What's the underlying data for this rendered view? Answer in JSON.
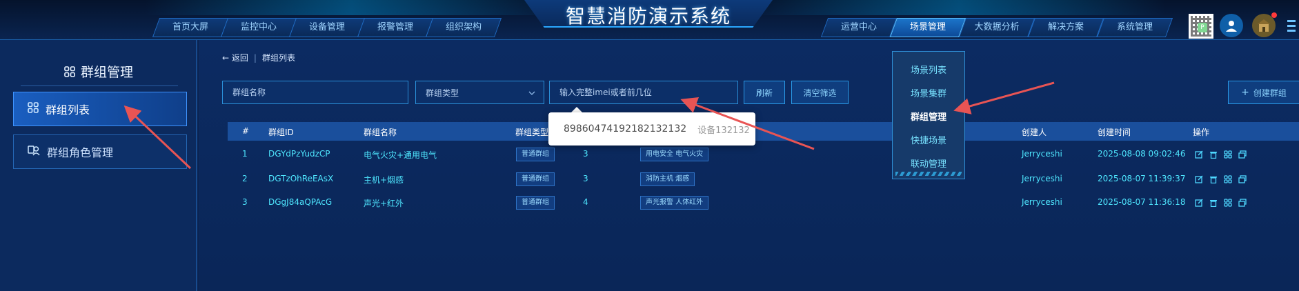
{
  "header": {
    "title": "智慧消防演示系统",
    "nav_left": [
      "首页大屏",
      "监控中心",
      "设备管理",
      "报警管理",
      "组织架构"
    ],
    "nav_right": [
      "运营中心",
      "场景管理",
      "大数据分析",
      "解决方案",
      "系统管理"
    ],
    "active_nav": "场景管理",
    "icons": [
      "qr-code-icon",
      "user-avatar-icon",
      "account-avatar-icon",
      "more-icon"
    ]
  },
  "sidebar": {
    "title": "群组管理",
    "items": [
      {
        "label": "群组列表",
        "icon": "grid-icon",
        "active": true
      },
      {
        "label": "群组角色管理",
        "icon": "user-group-icon",
        "active": false
      }
    ]
  },
  "breadcrumb": {
    "back": "返回",
    "current": "群组列表"
  },
  "filters": {
    "group_name_placeholder": "群组名称",
    "group_type_placeholder": "群组类型",
    "imei_placeholder": "输入完整imei或者前几位",
    "refresh_label": "刷新",
    "clear_label": "清空筛选",
    "create_label": "创建群组"
  },
  "imei_suggestion": {
    "imei": "89860474192182132132",
    "device": "设备132132"
  },
  "scene_menu": {
    "items": [
      "场景列表",
      "场景集群",
      "群组管理",
      "快捷场景",
      "联动管理"
    ],
    "active": "群组管理"
  },
  "table": {
    "columns": [
      "#",
      "群组ID",
      "群组名称",
      "群组类型",
      "创建人",
      "创建时间",
      "操作"
    ],
    "rows": [
      {
        "index": "1",
        "id": "DGYdPzYudzCP",
        "name": "电气火灾+通用电气",
        "type": "普通群组",
        "count": "3",
        "tags": "用电安全 电气火灾",
        "creator": "Jerryceshi",
        "created": "2025-08-08 09:02:46"
      },
      {
        "index": "2",
        "id": "DGTzOhReEAsX",
        "name": "主机+烟感",
        "type": "普通群组",
        "count": "3",
        "tags": "消防主机 烟感",
        "creator": "Jerryceshi",
        "created": "2025-08-07 11:39:37"
      },
      {
        "index": "3",
        "id": "DGgJ84aQPAcG",
        "name": "声光+红外",
        "type": "普通群组",
        "count": "4",
        "tags": "声光报警 人体红外",
        "creator": "Jerryceshi",
        "created": "2025-08-07 11:36:18"
      }
    ],
    "row_actions": [
      "edit-icon",
      "delete-icon",
      "grid-icon",
      "copy-icon"
    ]
  },
  "colors": {
    "accent": "#4fe7ff",
    "annotation_arrow": "#e85454",
    "background": "#0b2350"
  }
}
